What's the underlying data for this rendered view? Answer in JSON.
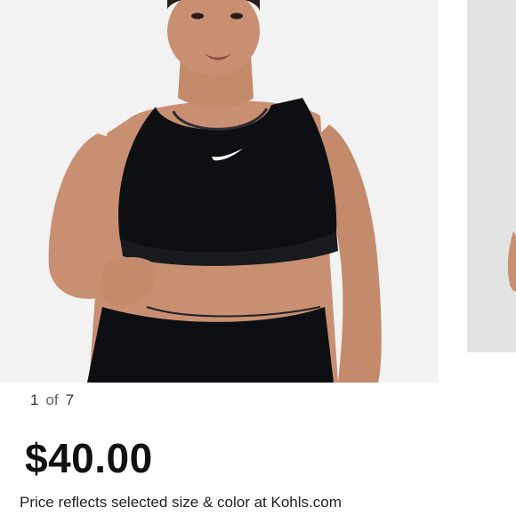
{
  "carousel": {
    "current": "1",
    "separator": "of",
    "total": "7"
  },
  "product": {
    "price": "$40.00",
    "price_note": "Price reflects selected size & color at Kohls.com"
  },
  "colors": {
    "image_background": "#f2f2f2",
    "next_image_background": "#e3e3e3",
    "garment": "#0d0f12",
    "skin": "#c98f72"
  }
}
